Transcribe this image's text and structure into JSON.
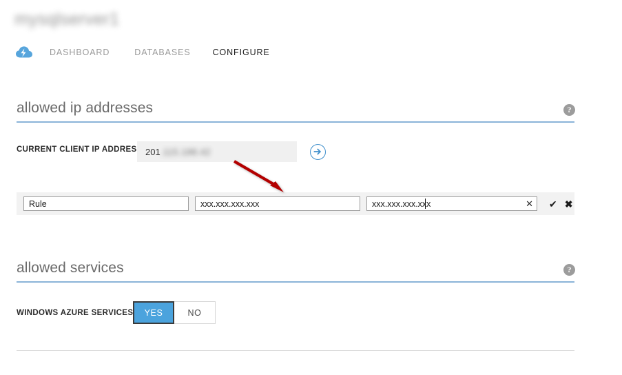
{
  "page": {
    "title": "mysqlserver1"
  },
  "nav": {
    "service_icon": "cloud-lightning-icon",
    "tabs": [
      {
        "label": "DASHBOARD",
        "active": false
      },
      {
        "label": "DATABASES",
        "active": false
      },
      {
        "label": "CONFIGURE",
        "active": true
      }
    ]
  },
  "sections": {
    "allowed_ip": {
      "heading": "allowed ip addresses",
      "help_glyph": "?",
      "client_ip": {
        "label": "CURRENT CLIENT IP ADDRESS",
        "value_prefix": "201",
        "value_redacted": ".115.188.42",
        "add_button_icon": "arrow-right-circle-icon"
      },
      "rule_row": {
        "name_value": "Rule",
        "name_placeholder": "Rule",
        "start_ip_value": "xxx.xxx.xxx.xxx",
        "start_ip_placeholder": "xxx.xxx.xxx.xxx",
        "end_ip_value": "xxx.xxx.xxx.xxx",
        "end_ip_placeholder": "xxx.xxx.xxx.xxx",
        "clear_glyph": "✕",
        "accept_glyph": "✔",
        "cancel_glyph": "✖"
      }
    },
    "allowed_services": {
      "heading": "allowed services",
      "help_glyph": "?",
      "azure_services": {
        "label": "WINDOWS AZURE SERVICES",
        "options": [
          {
            "label": "YES",
            "selected": true
          },
          {
            "label": "NO",
            "selected": false
          }
        ]
      }
    }
  },
  "annotation": {
    "arrow_color": "#b30000"
  }
}
